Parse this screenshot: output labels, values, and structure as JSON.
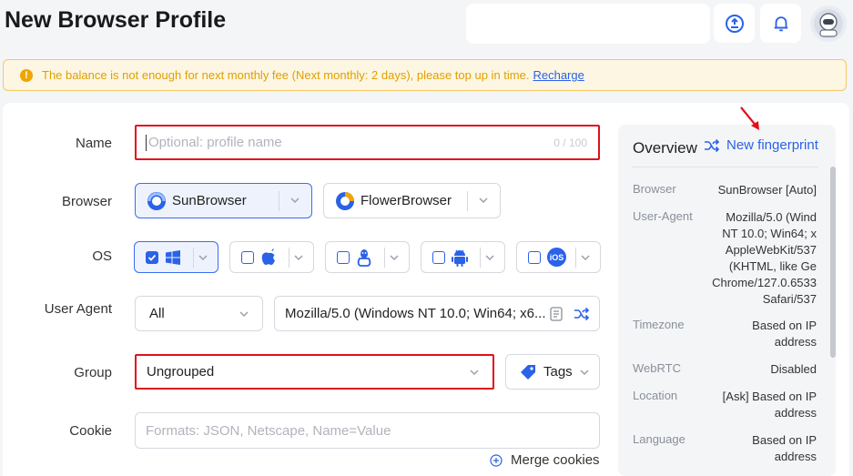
{
  "header": {
    "title": "New Browser Profile"
  },
  "alert": {
    "message": "The balance is not enough for next monthly fee (Next monthly: 2 days), please top up in time.",
    "link": "Recharge"
  },
  "form": {
    "name": {
      "label": "Name",
      "placeholder": "Optional: profile name",
      "counter": "0 / 100"
    },
    "browser": {
      "label": "Browser",
      "options": [
        {
          "label": "SunBrowser",
          "selected": true
        },
        {
          "label": "FlowerBrowser",
          "selected": false
        }
      ]
    },
    "os": {
      "label": "OS",
      "options": [
        {
          "icon": "windows-icon",
          "checked": true
        },
        {
          "icon": "apple-icon",
          "checked": false
        },
        {
          "icon": "linux-icon",
          "checked": false
        },
        {
          "icon": "android-icon",
          "checked": false
        },
        {
          "icon": "ios-icon",
          "checked": false,
          "text": "iOS"
        }
      ]
    },
    "user_agent": {
      "label": "User Agent",
      "filter_value": "All",
      "value": "Mozilla/5.0 (Windows NT 10.0; Win64; x6..."
    },
    "group": {
      "label": "Group",
      "value": "Ungrouped",
      "tags_label": "Tags"
    },
    "cookie": {
      "label": "Cookie",
      "placeholder": "Formats: JSON, Netscape, Name=Value",
      "merge_label": "Merge cookies"
    }
  },
  "overview": {
    "title": "Overview",
    "new_fingerprint": "New fingerprint",
    "rows": [
      {
        "key": "Browser",
        "value": "SunBrowser [Auto]"
      },
      {
        "key": "User-Agent",
        "value": "Mozilla/5.0 (Wind\nNT 10.0; Win64; x\nAppleWebKit/537\n(KHTML, like Ge\nChrome/127.0.6533\nSafari/537"
      },
      {
        "key": "Timezone",
        "value": "Based on IP\naddress"
      },
      {
        "key": "WebRTC",
        "value": "Disabled"
      },
      {
        "key": "Location",
        "value": "[Ask] Based on IP\naddress"
      },
      {
        "key": "Language",
        "value": "Based on IP\naddress"
      }
    ]
  },
  "colors": {
    "accent": "#2a62e8",
    "alert_text": "#e0a000",
    "highlight": "#e0101a"
  }
}
